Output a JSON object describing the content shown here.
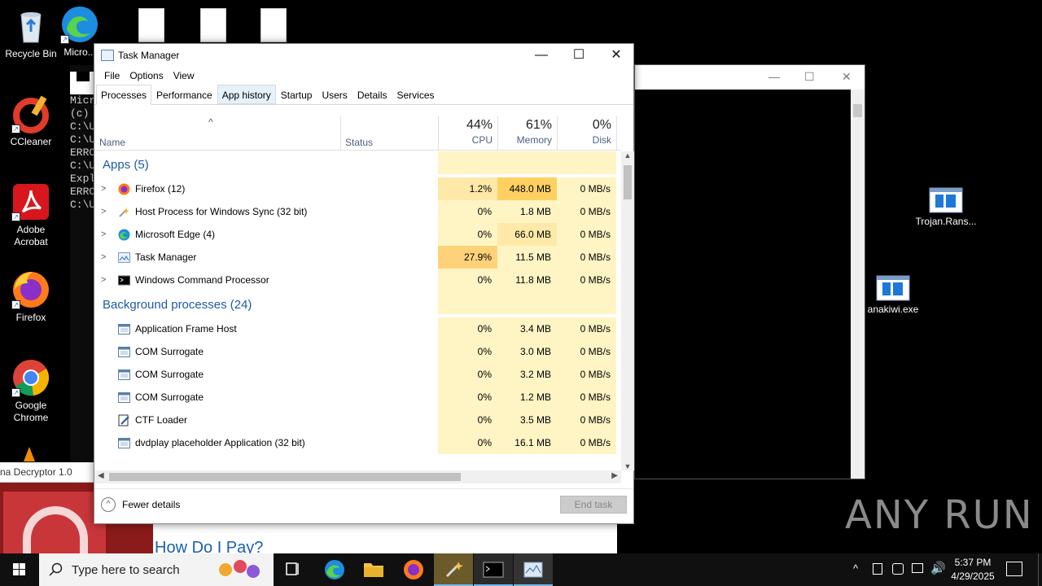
{
  "desktop": {
    "icons": [
      {
        "label": "Recycle Bin"
      },
      {
        "label": "Micro..."
      },
      {
        "label": "CCleaner"
      },
      {
        "label": "Adobe Acrobat"
      },
      {
        "label": "Firefox"
      },
      {
        "label": "Google Chrome"
      },
      {
        "label": "Trojan.Rans..."
      },
      {
        "label": "anakiwi.exe"
      }
    ],
    "watermark": "ANY RUN"
  },
  "cmd": {
    "lines": [
      "Micr",
      "(c)",
      "",
      "C:\\U",
      "",
      "C:\\U",
      "ERRO",
      "",
      "C:\\U",
      "Expl",
      "ERRO",
      "",
      "C:\\U"
    ]
  },
  "task_manager": {
    "title": "Task Manager",
    "menu": [
      "File",
      "Options",
      "View"
    ],
    "tabs": [
      "Processes",
      "Performance",
      "App history",
      "Startup",
      "Users",
      "Details",
      "Services"
    ],
    "active_tab": "Processes",
    "columns": {
      "name": "Name",
      "status": "Status",
      "cpu": {
        "pct": "44%",
        "label": "CPU"
      },
      "memory": {
        "pct": "61%",
        "label": "Memory"
      },
      "disk": {
        "pct": "0%",
        "label": "Disk"
      }
    },
    "groups": [
      {
        "title": "Apps (5)",
        "rows": [
          {
            "name": "Firefox (12)",
            "icon": "firefox-icon",
            "cpu": "1.2%",
            "mem": "448.0 MB",
            "disk": "0 MB/s",
            "expand": true,
            "cpu_heat": "y2",
            "mem_heat": "y4"
          },
          {
            "name": "Host Process for Windows Sync (32 bit)",
            "icon": "sync-host-icon",
            "cpu": "0%",
            "mem": "1.8 MB",
            "disk": "0 MB/s",
            "expand": true,
            "cpu_heat": "y1",
            "mem_heat": "y1"
          },
          {
            "name": "Microsoft Edge (4)",
            "icon": "edge-icon",
            "cpu": "0%",
            "mem": "66.0 MB",
            "disk": "0 MB/s",
            "expand": true,
            "cpu_heat": "y1",
            "mem_heat": "y2"
          },
          {
            "name": "Task Manager",
            "icon": "task-manager-icon",
            "cpu": "27.9%",
            "mem": "11.5 MB",
            "disk": "0 MB/s",
            "expand": true,
            "cpu_heat": "y3",
            "mem_heat": "y1"
          },
          {
            "name": "Windows Command Processor",
            "icon": "cmd-icon",
            "cpu": "0%",
            "mem": "11.8 MB",
            "disk": "0 MB/s",
            "expand": true,
            "cpu_heat": "y1",
            "mem_heat": "y1"
          }
        ]
      },
      {
        "title": "Background processes (24)",
        "rows": [
          {
            "name": "Application Frame Host",
            "icon": "app-window-icon",
            "cpu": "0%",
            "mem": "3.4 MB",
            "disk": "0 MB/s",
            "expand": false,
            "cpu_heat": "y1",
            "mem_heat": "y1"
          },
          {
            "name": "COM Surrogate",
            "icon": "app-window-icon",
            "cpu": "0%",
            "mem": "3.0 MB",
            "disk": "0 MB/s",
            "expand": false,
            "cpu_heat": "y1",
            "mem_heat": "y1"
          },
          {
            "name": "COM Surrogate",
            "icon": "app-window-icon",
            "cpu": "0%",
            "mem": "3.2 MB",
            "disk": "0 MB/s",
            "expand": false,
            "cpu_heat": "y1",
            "mem_heat": "y1"
          },
          {
            "name": "COM Surrogate",
            "icon": "app-window-icon",
            "cpu": "0%",
            "mem": "1.2 MB",
            "disk": "0 MB/s",
            "expand": false,
            "cpu_heat": "y1",
            "mem_heat": "y1"
          },
          {
            "name": "CTF Loader",
            "icon": "ctf-loader-icon",
            "cpu": "0%",
            "mem": "3.5 MB",
            "disk": "0 MB/s",
            "expand": false,
            "cpu_heat": "y1",
            "mem_heat": "y1"
          },
          {
            "name": "dvdplay placeholder Application (32 bit)",
            "icon": "app-window-icon",
            "cpu": "0%",
            "mem": "16.1 MB",
            "disk": "0 MB/s",
            "expand": false,
            "cpu_heat": "y1",
            "mem_heat": "y1"
          }
        ]
      }
    ],
    "footer": {
      "fewer_details": "Fewer details",
      "end_task": "End task"
    }
  },
  "ransom_window": {
    "title": "na Decryptor 1.0",
    "heading": "How Do I Pay?"
  },
  "taskbar": {
    "search_placeholder": "Type here to search",
    "time": "5:37 PM",
    "date": "4/29/2025"
  },
  "colors": {
    "heat_light": "#fff4c4",
    "heat_mid": "#ffe9a8",
    "heat_high": "#ffd27a",
    "group_title": "#1e5aa8"
  }
}
